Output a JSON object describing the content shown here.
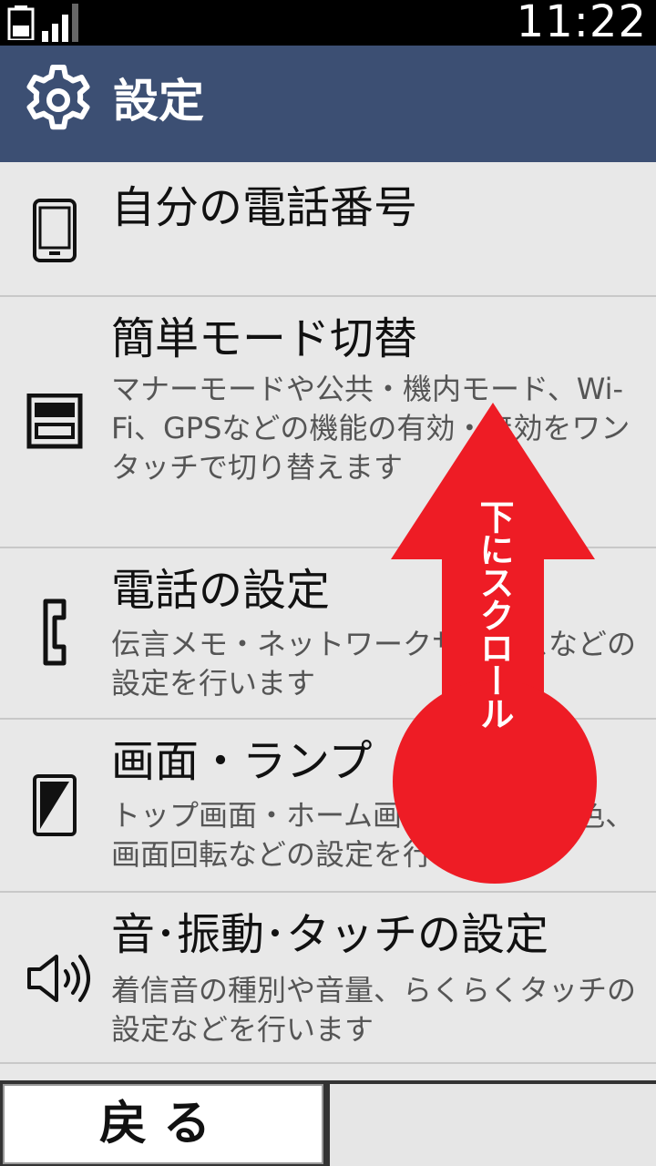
{
  "status_bar": {
    "time": "11:22"
  },
  "header": {
    "title": "設定"
  },
  "settings_items": [
    {
      "name": "自分の電話番号",
      "desc": "",
      "icon": "phone-device-icon"
    },
    {
      "name": "簡単モード切替",
      "desc": "マナーモードや公共・機内モード、Wi-Fi、GPSなどの機能の有効・無効をワンタッチで切り替えます",
      "icon": "toggle-mode-icon"
    },
    {
      "name": "電話の設定",
      "desc": "伝言メモ・ネットワークサービスなどの設定を行います",
      "icon": "handset-icon"
    },
    {
      "name": "画面・ランプ",
      "desc": "トップ画面・ホーム画面やランプ配色、画面回転などの設定を行います",
      "icon": "display-icon"
    },
    {
      "name": "音･振動･タッチの設定",
      "desc": "着信音の種別や音量、らくらくタッチの設定などを行います",
      "icon": "speaker-icon"
    }
  ],
  "overlay": {
    "label": "下にスクロール",
    "color": "#ee1c25"
  },
  "footer": {
    "back_label": "戻る"
  }
}
